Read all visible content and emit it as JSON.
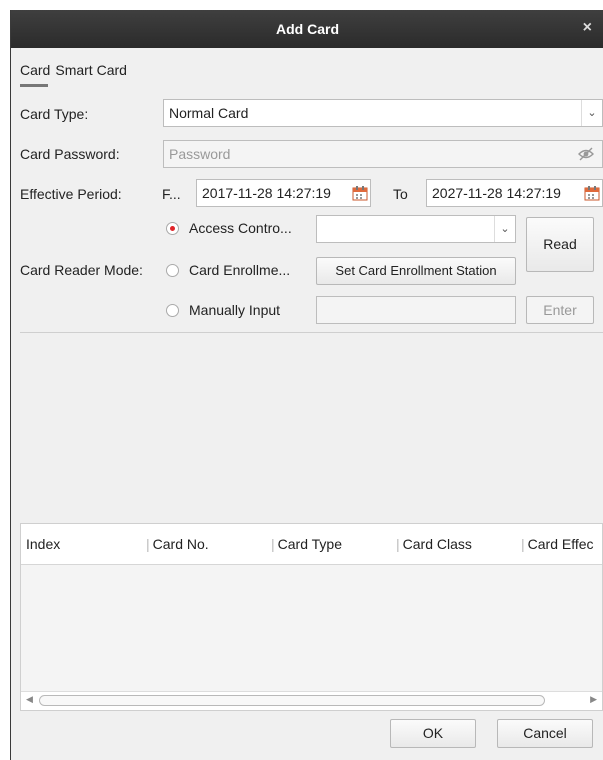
{
  "window": {
    "title": "Add Card",
    "close_glyph": "×"
  },
  "tabs": [
    {
      "label": "Card"
    },
    {
      "label": "Smart Card"
    }
  ],
  "form": {
    "card_type_label": "Card Type:",
    "card_type_value": "Normal Card",
    "card_password_label": "Card Password:",
    "card_password_placeholder": "Password",
    "effective_period_label": "Effective Period:",
    "from_label": "F...",
    "from_value": "2017-11-28 14:27:19",
    "to_label": "To",
    "to_value": "2027-11-28 14:27:19",
    "card_reader_mode_label": "Card Reader Mode:",
    "mode_access_control": "Access Contro...",
    "mode_card_enrollment": "Card Enrollme...",
    "mode_manual": "Manually Input",
    "access_control_value": "",
    "set_enrollment_button": "Set Card Enrollment Station",
    "manual_value": "",
    "read_button": "Read",
    "enter_button": "Enter"
  },
  "table": {
    "columns": [
      "Index",
      "Card No.",
      "Card Type",
      "Card Class",
      "Card Effec"
    ]
  },
  "footer": {
    "ok_button": "OK",
    "cancel_button": "Cancel"
  },
  "colors": {
    "titlebar": "#2f2f2f",
    "accent_radio": "#e0252a",
    "dialog_bg": "#f0f0f0"
  }
}
